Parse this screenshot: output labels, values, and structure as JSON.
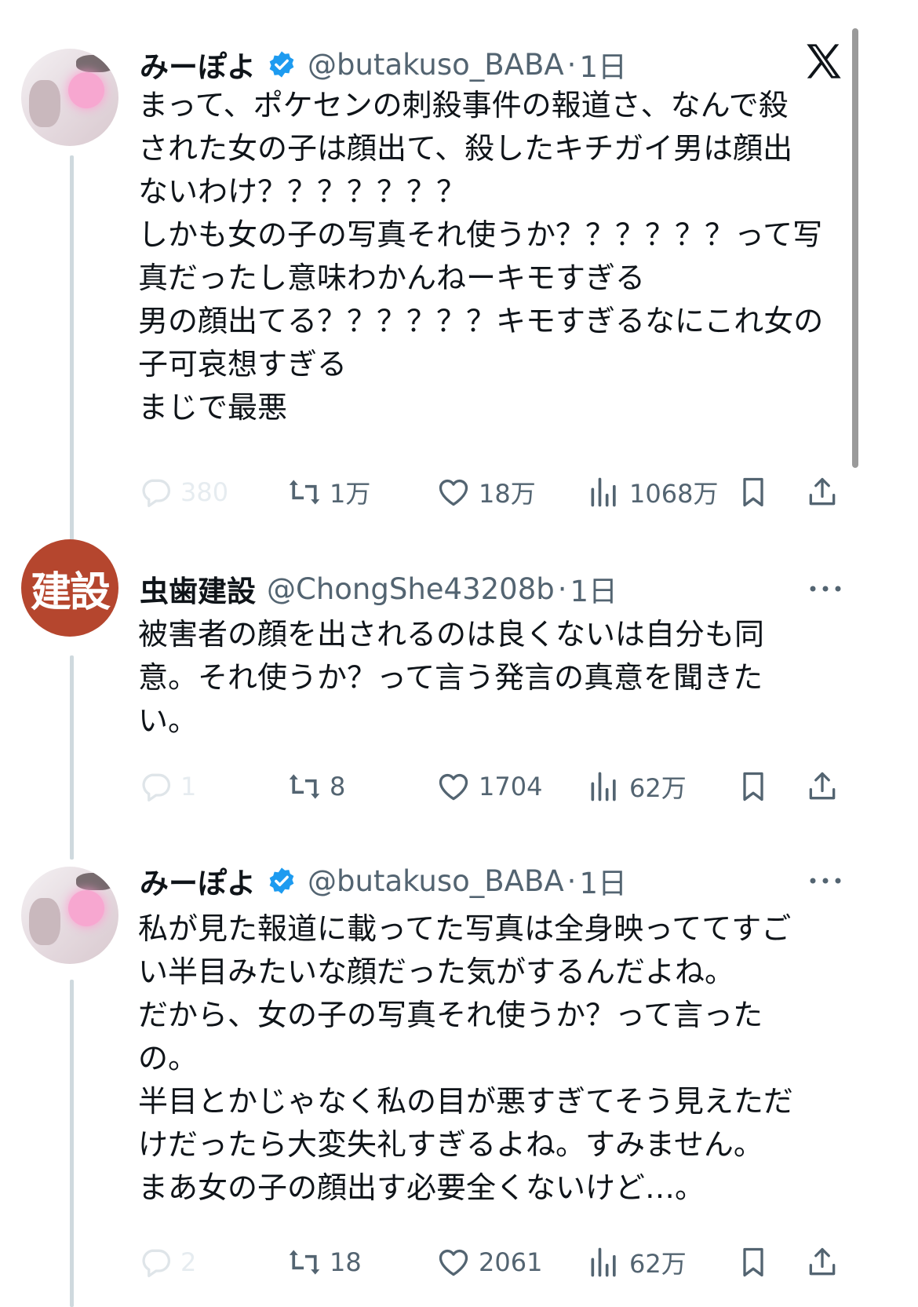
{
  "tweets": [
    {
      "avatar_icon": "avatar-photo",
      "display_name": "みーぽよ",
      "verified": true,
      "handle": "@butakuso_BABA",
      "separator": "·",
      "time": "1日",
      "lines": [
        "まって、ポケセンの刺殺事件の報道さ、なんで殺",
        "された女の子は顔出て、殺したキチガイ男は顔出",
        "ないわけ？？？？？？？",
        "しかも女の子の写真それ使うか？？？？？？って写",
        "真だったし意味わかんねーキモすぎる",
        "男の顔出てる？？？？？？キモすぎるなにこれ女の",
        "子可哀想すぎる",
        "まじで最悪"
      ],
      "replies": "380",
      "reposts": "1万",
      "likes": "18万",
      "views": "1068万"
    },
    {
      "avatar_text": "建設",
      "avatar_color": "#b5462e",
      "display_name": "虫歯建設",
      "handle": "@ChongShe43208b",
      "separator": "·",
      "time": "1日",
      "lines": [
        "被害者の顔を出されるのは良くないは自分も同",
        "意。それ使うか？って言う発言の真意を聞きた",
        "い。"
      ],
      "replies": "1",
      "reposts": "8",
      "likes": "1704",
      "views": "62万"
    },
    {
      "avatar_icon": "avatar-photo",
      "display_name": "みーぽよ",
      "verified": true,
      "handle": "@butakuso_BABA",
      "separator": "·",
      "time": "1日",
      "lines": [
        "私が見た報道に載ってた写真は全身映っててすご",
        "い半目みたいな顔だった気がするんだよね。",
        "だから、女の子の写真それ使うか？って言った",
        "の。",
        "半目とかじゃなく私の目が悪すぎてそう見えただ",
        "けだったら大変失礼すぎるよね。すみません。",
        "まあ女の子の顔出す必要全くないけど…。"
      ],
      "replies": "2",
      "reposts": "18",
      "likes": "2061",
      "views": "62万"
    }
  ],
  "colors": {
    "text": "#0f1419",
    "secondary": "#536471",
    "verified": "#1d9bf0",
    "thread_line": "#cfd9de"
  },
  "icons": [
    "x-logo",
    "verified-icon",
    "more-icon",
    "reply-icon",
    "repost-icon",
    "like-icon",
    "views-icon",
    "bookmark-icon",
    "share-icon"
  ]
}
